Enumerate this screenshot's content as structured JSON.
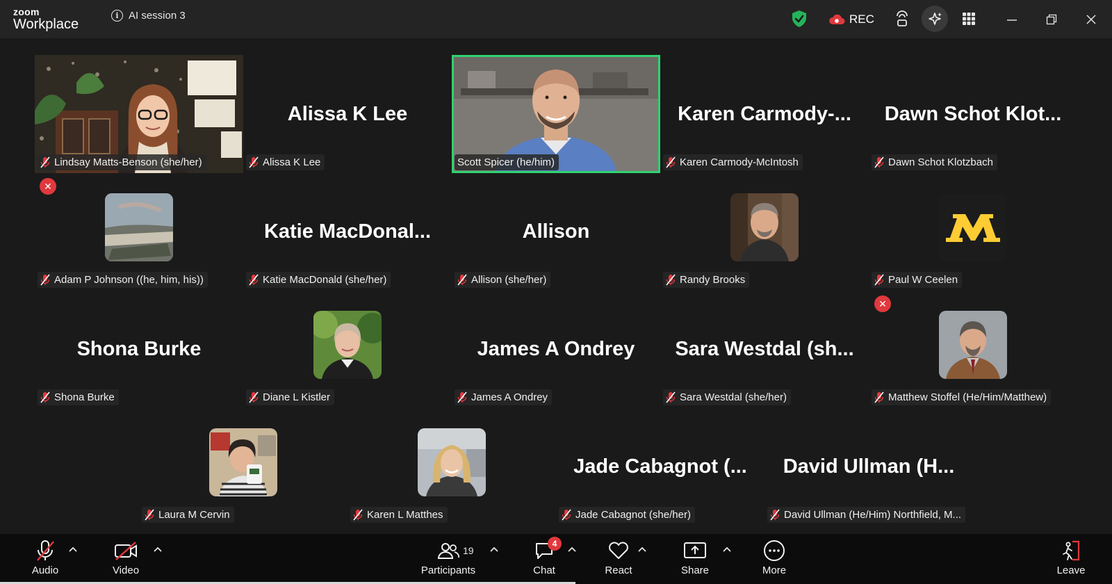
{
  "app": {
    "brand_top": "zoom",
    "brand_bottom": "Workplace",
    "session_title": "AI session 3"
  },
  "titlebar": {
    "rec_label": "REC"
  },
  "colors": {
    "active_border": "#2fd26e",
    "mute_red": "#e0393e",
    "shield_green": "#25b35a"
  },
  "tiles": [
    {
      "display": "",
      "label": "Lindsay Matts-Benson (she/her)",
      "type": "video"
    },
    {
      "display": "Alissa K Lee",
      "label": "Alissa K Lee",
      "type": "name"
    },
    {
      "display": "",
      "label": "Scott Spicer (he/him)",
      "type": "video",
      "active": true
    },
    {
      "display": "Karen  Carmody-...",
      "label": "Karen Carmody-McIntosh",
      "type": "name"
    },
    {
      "display": "Dawn  Schot  Klot...",
      "label": "Dawn Schot Klotzbach",
      "type": "name"
    },
    {
      "display": "",
      "label": "Adam P Johnson ((he, him, his))",
      "type": "avatar"
    },
    {
      "display": "Katie  MacDonal...",
      "label": "Katie MacDonald (she/her)",
      "type": "name"
    },
    {
      "display": "Allison",
      "label": "Allison (she/her)",
      "type": "name"
    },
    {
      "display": "",
      "label": "Randy Brooks",
      "type": "avatar"
    },
    {
      "display": "",
      "label": "Paul W Ceelen",
      "type": "avatar"
    },
    {
      "display": "Shona Burke",
      "label": "Shona Burke",
      "type": "name"
    },
    {
      "display": "",
      "label": "Diane L Kistler",
      "type": "avatar"
    },
    {
      "display": "James A Ondrey",
      "label": "James A Ondrey",
      "type": "name"
    },
    {
      "display": "Sara  Westdal  (sh...",
      "label": "Sara Westdal (she/her)",
      "type": "name"
    },
    {
      "display": "",
      "label": "Matthew Stoffel (He/Him/Matthew)",
      "type": "avatar"
    },
    {
      "display": "",
      "label": "Laura M Cervin",
      "type": "avatar"
    },
    {
      "display": "",
      "label": "Karen L Matthes",
      "type": "avatar"
    },
    {
      "display": "Jade  Cabagnot  (...",
      "label": "Jade Cabagnot (she/her)",
      "type": "name"
    },
    {
      "display": "David  Ullman  (H...",
      "label": "David Ullman (He/Him) Northfield, M...",
      "type": "name"
    }
  ],
  "toolbar": {
    "audio": "Audio",
    "video": "Video",
    "participants": "Participants",
    "participant_count": "19",
    "chat": "Chat",
    "chat_badge": "4",
    "react": "React",
    "share": "Share",
    "more": "More",
    "leave": "Leave"
  }
}
